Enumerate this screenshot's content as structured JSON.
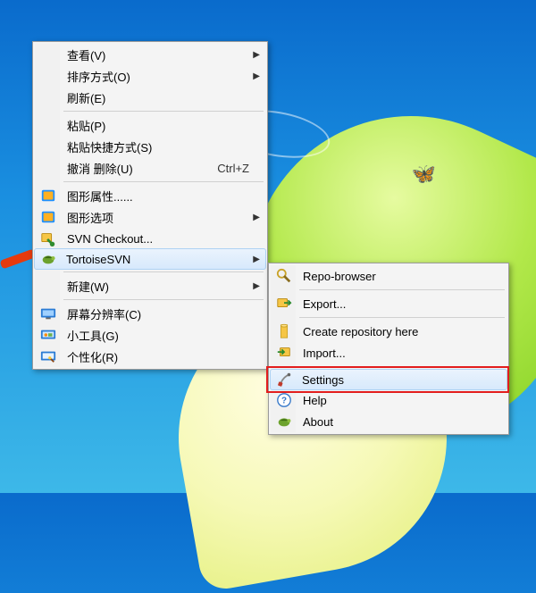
{
  "main_menu": {
    "groups": [
      [
        {
          "label": "查看(V)",
          "icon": null,
          "submenu": true
        },
        {
          "label": "排序方式(O)",
          "icon": null,
          "submenu": true
        },
        {
          "label": "刷新(E)",
          "icon": null
        }
      ],
      [
        {
          "label": "粘贴(P)",
          "icon": null
        },
        {
          "label": "粘贴快捷方式(S)",
          "icon": null
        },
        {
          "label": "撤消 删除(U)",
          "icon": null,
          "shortcut": "Ctrl+Z"
        }
      ],
      [
        {
          "label": "图形属性......",
          "icon": "intel"
        },
        {
          "label": "图形选项",
          "icon": "intel",
          "submenu": true
        },
        {
          "label": "SVN Checkout...",
          "icon": "svn-checkout"
        },
        {
          "label": "TortoiseSVN",
          "icon": "tortoise",
          "submenu": true,
          "hover": true
        }
      ],
      [
        {
          "label": "新建(W)",
          "icon": null,
          "submenu": true
        }
      ],
      [
        {
          "label": "屏幕分辨率(C)",
          "icon": "resolution"
        },
        {
          "label": "小工具(G)",
          "icon": "gadgets"
        },
        {
          "label": "个性化(R)",
          "icon": "personalize"
        }
      ]
    ]
  },
  "sub_menu": {
    "groups": [
      [
        {
          "label": "Repo-browser",
          "icon": "repo-browser"
        }
      ],
      [
        {
          "label": "Export...",
          "icon": "export"
        }
      ],
      [
        {
          "label": "Create repository here",
          "icon": "create-repo"
        },
        {
          "label": "Import...",
          "icon": "import"
        }
      ],
      [
        {
          "label": "Settings",
          "icon": "settings",
          "hover": true,
          "highlight": true
        },
        {
          "label": "Help",
          "icon": "help"
        },
        {
          "label": "About",
          "icon": "about"
        }
      ]
    ]
  }
}
